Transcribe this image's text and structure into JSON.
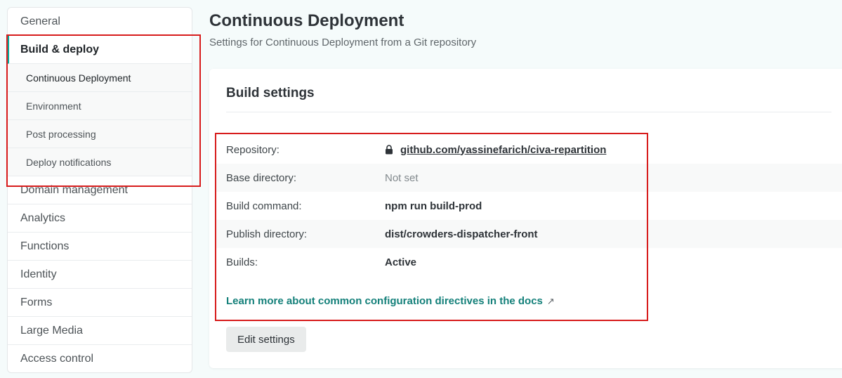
{
  "sidebar": {
    "items": [
      {
        "label": "General"
      },
      {
        "label": "Build & deploy"
      },
      {
        "label": "Domain management"
      },
      {
        "label": "Analytics"
      },
      {
        "label": "Functions"
      },
      {
        "label": "Identity"
      },
      {
        "label": "Forms"
      },
      {
        "label": "Large Media"
      },
      {
        "label": "Access control"
      }
    ],
    "subitems": [
      {
        "label": "Continuous Deployment"
      },
      {
        "label": "Environment"
      },
      {
        "label": "Post processing"
      },
      {
        "label": "Deploy notifications"
      }
    ]
  },
  "page": {
    "title": "Continuous Deployment",
    "subtitle": "Settings for Continuous Deployment from a Git repository"
  },
  "card": {
    "title": "Build settings",
    "settings": [
      {
        "key": "Repository:",
        "value": "github.com/yassinefarich/civa-repartition"
      },
      {
        "key": "Base directory:",
        "value": "Not set"
      },
      {
        "key": "Build command:",
        "value": "npm run build-prod"
      },
      {
        "key": "Publish directory:",
        "value": "dist/crowders-dispatcher-front"
      },
      {
        "key": "Builds:",
        "value": "Active"
      }
    ],
    "docs_link": "Learn more about common configuration directives in the docs",
    "docs_link_icon": "↗",
    "edit_button": "Edit settings"
  },
  "colors": {
    "accent": "#00ad9f",
    "link": "#14807a",
    "highlight": "#d71c1c"
  }
}
